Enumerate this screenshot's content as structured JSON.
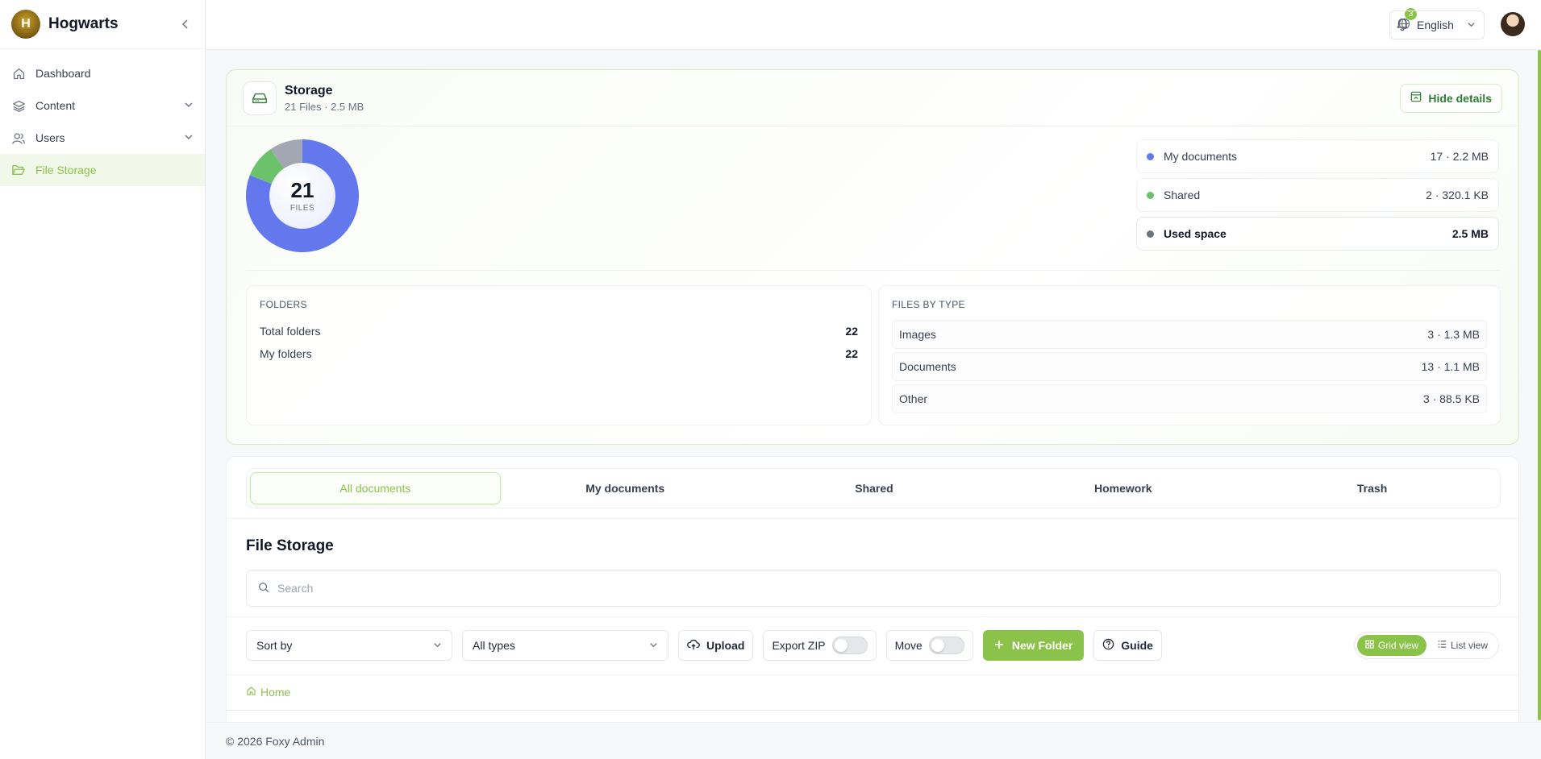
{
  "brand": {
    "name": "Hogwarts",
    "logo_letter": "H"
  },
  "sidebar": {
    "items": [
      {
        "label": "Dashboard",
        "icon": "home-icon"
      },
      {
        "label": "Content",
        "icon": "layers-icon"
      },
      {
        "label": "Users",
        "icon": "users-icon"
      },
      {
        "label": "File Storage",
        "icon": "folder-open-icon",
        "active": true
      }
    ]
  },
  "topbar": {
    "notifications_count": "3",
    "language": "English"
  },
  "storage": {
    "title": "Storage",
    "subtitle": "21 Files · 2.5 MB",
    "hide_details_label": "Hide details",
    "donut": {
      "total": "21",
      "label": "FILES"
    },
    "legend": [
      {
        "label": "My documents",
        "value": "17 · 2.2 MB",
        "color": "#6478ee"
      },
      {
        "label": "Shared",
        "value": "2 · 320.1 KB",
        "color": "#6cc26a"
      },
      {
        "label": "Used space",
        "value": "2.5 MB",
        "color": "#6b7280"
      }
    ],
    "folders": {
      "heading": "FOLDERS",
      "rows": [
        {
          "label": "Total folders",
          "value": "22"
        },
        {
          "label": "My folders",
          "value": "22"
        }
      ]
    },
    "types": {
      "heading": "FILES BY TYPE",
      "rows": [
        {
          "label": "Images",
          "value": "3 · 1.3 MB"
        },
        {
          "label": "Documents",
          "value": "13 · 1.1 MB"
        },
        {
          "label": "Other",
          "value": "3 · 88.5 KB"
        }
      ]
    }
  },
  "chart_data": {
    "type": "pie",
    "categories": [
      "My documents",
      "Shared",
      "Other"
    ],
    "values": [
      17,
      2,
      2
    ],
    "colors": [
      "#6478ee",
      "#6cc26a",
      "#a3a7b1"
    ]
  },
  "tabs": [
    "All documents",
    "My documents",
    "Shared",
    "Homework",
    "Trash"
  ],
  "file_storage": {
    "title": "File Storage",
    "search_placeholder": "Search",
    "sort_label": "Sort by",
    "type_label": "All types",
    "upload_label": "Upload",
    "export_label": "Export ZIP",
    "move_label": "Move",
    "new_folder_label": "New Folder",
    "guide_label": "Guide",
    "grid_view_label": "Grid view",
    "list_view_label": "List view",
    "breadcrumb_home": "Home"
  },
  "footer": {
    "text": "© 2026 Foxy Admin"
  }
}
